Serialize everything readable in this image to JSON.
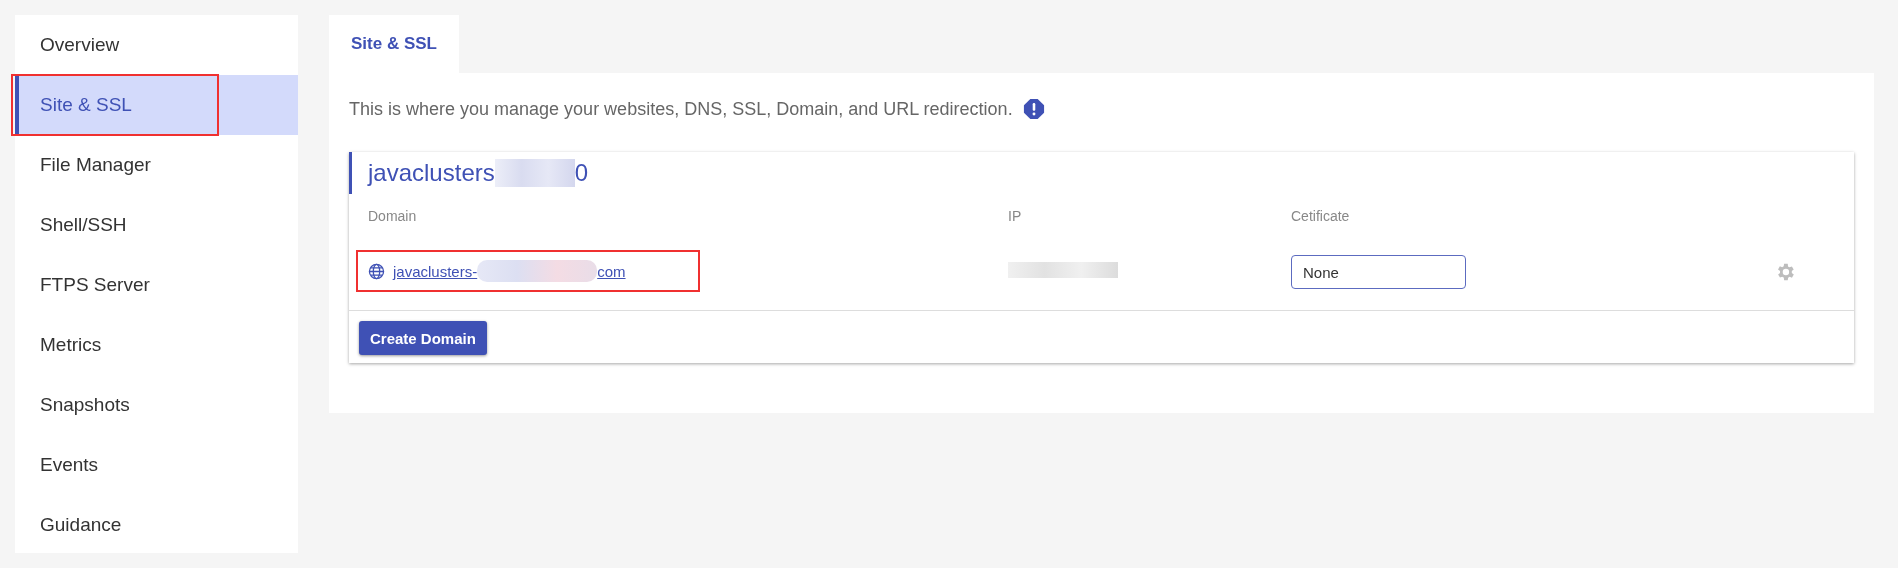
{
  "sidebar": {
    "items": [
      {
        "label": "Overview",
        "selected": false,
        "highlighted": false
      },
      {
        "label": "Site & SSL",
        "selected": true,
        "highlighted": true
      },
      {
        "label": "File Manager",
        "selected": false,
        "highlighted": false
      },
      {
        "label": "Shell/SSH",
        "selected": false,
        "highlighted": false
      },
      {
        "label": "FTPS Server",
        "selected": false,
        "highlighted": false
      },
      {
        "label": "Metrics",
        "selected": false,
        "highlighted": false
      },
      {
        "label": "Snapshots",
        "selected": false,
        "highlighted": false
      },
      {
        "label": "Events",
        "selected": false,
        "highlighted": false
      },
      {
        "label": "Guidance",
        "selected": false,
        "highlighted": false
      }
    ]
  },
  "tabs": [
    {
      "label": "Site & SSL",
      "selected": true
    }
  ],
  "description": "This is where you manage your websites, DNS, SSL, Domain, and URL redirection.",
  "site": {
    "title_start": "javaclusters",
    "title_end": "0",
    "table": {
      "columns": [
        "Domain",
        "IP",
        "Cetificate"
      ],
      "rows": [
        {
          "domain_start": "javaclusters-",
          "domain_end": "com",
          "highlighted": true,
          "certificate": "None"
        }
      ]
    }
  },
  "create_button": "Create Domain"
}
